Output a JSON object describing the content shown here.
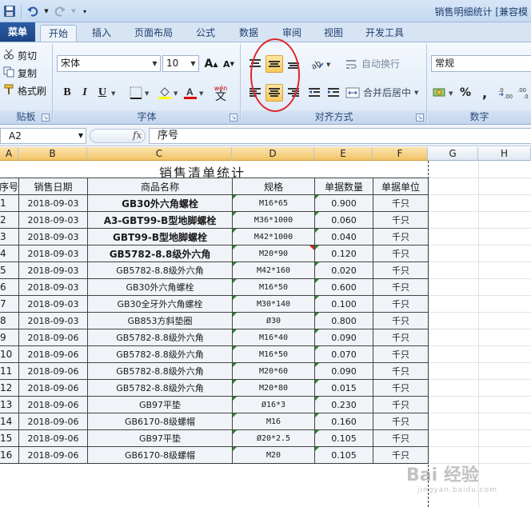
{
  "window": {
    "title": "销售明细统计 [兼容模"
  },
  "tabs": [
    {
      "label": "菜单",
      "type": "menu"
    },
    {
      "label": "开始",
      "active": true
    },
    {
      "label": "插入"
    },
    {
      "label": "页面布局"
    },
    {
      "label": "公式"
    },
    {
      "label": "数据"
    },
    {
      "label": "审阅"
    },
    {
      "label": "视图"
    },
    {
      "label": "开发工具"
    }
  ],
  "ribbon": {
    "clipboard": {
      "cut": "剪切",
      "copy": "复制",
      "format_painter": "格式刷",
      "label": "贴板"
    },
    "font": {
      "name": "宋体",
      "size": "10",
      "label": "字体",
      "bold": "B",
      "italic": "I",
      "underline": "U",
      "phonetic": "wén",
      "phonetic_char": "文",
      "grow": "A",
      "shrink": "A"
    },
    "alignment": {
      "wrap": "自动换行",
      "merge": "合并后居中",
      "label": "对齐方式"
    },
    "number": {
      "format": "常规",
      "label": "数字",
      "percent": "%",
      "comma": ","
    }
  },
  "formula_bar": {
    "cell_ref": "A2",
    "fx": "fx",
    "content": "序号"
  },
  "columns": [
    "A",
    "B",
    "C",
    "D",
    "E",
    "F",
    "G",
    "H"
  ],
  "sheet": {
    "title": "销售清单统计",
    "headers": [
      "序号",
      "销售日期",
      "商品名称",
      "规格",
      "单据数量",
      "单据单位"
    ],
    "rows": [
      {
        "idx": "1",
        "date": "2018-09-03",
        "name": "GB30外六角螺栓",
        "spec": "M16*65",
        "qty": "0.900",
        "unit": "千只"
      },
      {
        "idx": "2",
        "date": "2018-09-03",
        "name": "A3-GBT99-B型地脚螺栓",
        "spec": "M36*1000",
        "qty": "0.060",
        "unit": "千只"
      },
      {
        "idx": "3",
        "date": "2018-09-03",
        "name": "GBT99-B型地脚螺栓",
        "spec": "M42*1000",
        "qty": "0.040",
        "unit": "千只"
      },
      {
        "idx": "4",
        "date": "2018-09-03",
        "name": "GB5782-8.8级外六角",
        "spec": "M20*90",
        "qty": "0.120",
        "unit": "千只"
      },
      {
        "idx": "5",
        "date": "2018-09-03",
        "name": "GB5782-8.8级外六角",
        "spec": "M42*160",
        "qty": "0.020",
        "unit": "千只"
      },
      {
        "idx": "6",
        "date": "2018-09-03",
        "name": "GB30外六角螺栓",
        "spec": "M16*50",
        "qty": "0.600",
        "unit": "千只"
      },
      {
        "idx": "7",
        "date": "2018-09-03",
        "name": "GB30全牙外六角螺栓",
        "spec": "M30*140",
        "qty": "0.100",
        "unit": "千只"
      },
      {
        "idx": "8",
        "date": "2018-09-03",
        "name": "GB853方斜垫圈",
        "spec": "Ø30",
        "qty": "0.800",
        "unit": "千只"
      },
      {
        "idx": "9",
        "date": "2018-09-06",
        "name": "GB5782-8.8级外六角",
        "spec": "M16*40",
        "qty": "0.090",
        "unit": "千只"
      },
      {
        "idx": "10",
        "date": "2018-09-06",
        "name": "GB5782-8.8级外六角",
        "spec": "M16*50",
        "qty": "0.070",
        "unit": "千只"
      },
      {
        "idx": "11",
        "date": "2018-09-06",
        "name": "GB5782-8.8级外六角",
        "spec": "M20*60",
        "qty": "0.090",
        "unit": "千只"
      },
      {
        "idx": "12",
        "date": "2018-09-06",
        "name": "GB5782-8.8级外六角",
        "spec": "M20*80",
        "qty": "0.015",
        "unit": "千只"
      },
      {
        "idx": "13",
        "date": "2018-09-06",
        "name": "GB97平垫",
        "spec": "Ø16*3",
        "qty": "0.230",
        "unit": "千只"
      },
      {
        "idx": "14",
        "date": "2018-09-06",
        "name": "GB6170-8级螺帽",
        "spec": "M16",
        "qty": "0.160",
        "unit": "千只"
      },
      {
        "idx": "15",
        "date": "2018-09-06",
        "name": "GB97平垫",
        "spec": "Ø20*2.5",
        "qty": "0.105",
        "unit": "千只"
      },
      {
        "idx": "16",
        "date": "2018-09-06",
        "name": "GB6170-8级螺帽",
        "spec": "M20",
        "qty": "0.105",
        "unit": "千只"
      }
    ]
  },
  "watermark": {
    "text": "Bai 经验",
    "sub": "jingyan.baidu.com"
  }
}
